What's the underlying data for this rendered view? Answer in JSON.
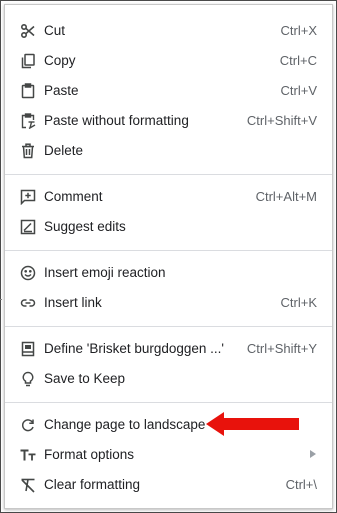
{
  "menu": {
    "items": [
      {
        "label": "Cut",
        "shortcut": "Ctrl+X",
        "icon": "scissors-icon"
      },
      {
        "label": "Copy",
        "shortcut": "Ctrl+C",
        "icon": "copy-icon"
      },
      {
        "label": "Paste",
        "shortcut": "Ctrl+V",
        "icon": "clipboard-icon"
      },
      {
        "label": "Paste without formatting",
        "shortcut": "Ctrl+Shift+V",
        "icon": "clipboard-clear-format-icon"
      },
      {
        "label": "Delete",
        "shortcut": "",
        "icon": "trash-icon"
      },
      {
        "label": "Comment",
        "shortcut": "Ctrl+Alt+M",
        "icon": "add-comment-icon"
      },
      {
        "label": "Suggest edits",
        "shortcut": "",
        "icon": "suggest-edit-icon"
      },
      {
        "label": "Insert emoji reaction",
        "shortcut": "",
        "icon": "emoji-icon"
      },
      {
        "label": "Insert link",
        "shortcut": "Ctrl+K",
        "icon": "link-icon"
      },
      {
        "label": "Define 'Brisket burgdoggen ...'",
        "shortcut": "Ctrl+Shift+Y",
        "icon": "dictionary-icon"
      },
      {
        "label": "Save to Keep",
        "shortcut": "",
        "icon": "lightbulb-icon"
      },
      {
        "label": "Change page to landscape",
        "shortcut": "",
        "icon": "rotate-icon"
      },
      {
        "label": "Format options",
        "shortcut": "",
        "icon": "text-format-icon",
        "has_submenu": true
      },
      {
        "label": "Clear formatting",
        "shortcut": "Ctrl+\\",
        "icon": "clear-format-icon"
      }
    ]
  },
  "annotation": {
    "arrow_color": "#e8120c",
    "points_to": "Change page to landscape"
  }
}
